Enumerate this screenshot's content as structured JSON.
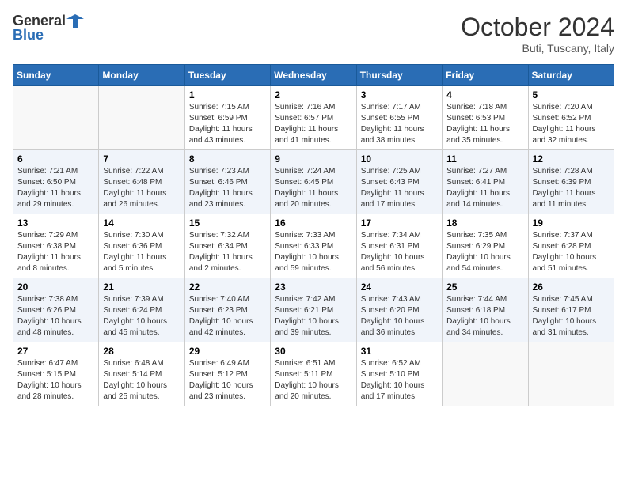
{
  "header": {
    "logo_line1": "General",
    "logo_line2": "Blue",
    "month": "October 2024",
    "location": "Buti, Tuscany, Italy"
  },
  "days_of_week": [
    "Sunday",
    "Monday",
    "Tuesday",
    "Wednesday",
    "Thursday",
    "Friday",
    "Saturday"
  ],
  "weeks": [
    [
      {
        "day": "",
        "info": ""
      },
      {
        "day": "",
        "info": ""
      },
      {
        "day": "1",
        "info": "Sunrise: 7:15 AM\nSunset: 6:59 PM\nDaylight: 11 hours\nand 43 minutes."
      },
      {
        "day": "2",
        "info": "Sunrise: 7:16 AM\nSunset: 6:57 PM\nDaylight: 11 hours\nand 41 minutes."
      },
      {
        "day": "3",
        "info": "Sunrise: 7:17 AM\nSunset: 6:55 PM\nDaylight: 11 hours\nand 38 minutes."
      },
      {
        "day": "4",
        "info": "Sunrise: 7:18 AM\nSunset: 6:53 PM\nDaylight: 11 hours\nand 35 minutes."
      },
      {
        "day": "5",
        "info": "Sunrise: 7:20 AM\nSunset: 6:52 PM\nDaylight: 11 hours\nand 32 minutes."
      }
    ],
    [
      {
        "day": "6",
        "info": "Sunrise: 7:21 AM\nSunset: 6:50 PM\nDaylight: 11 hours\nand 29 minutes."
      },
      {
        "day": "7",
        "info": "Sunrise: 7:22 AM\nSunset: 6:48 PM\nDaylight: 11 hours\nand 26 minutes."
      },
      {
        "day": "8",
        "info": "Sunrise: 7:23 AM\nSunset: 6:46 PM\nDaylight: 11 hours\nand 23 minutes."
      },
      {
        "day": "9",
        "info": "Sunrise: 7:24 AM\nSunset: 6:45 PM\nDaylight: 11 hours\nand 20 minutes."
      },
      {
        "day": "10",
        "info": "Sunrise: 7:25 AM\nSunset: 6:43 PM\nDaylight: 11 hours\nand 17 minutes."
      },
      {
        "day": "11",
        "info": "Sunrise: 7:27 AM\nSunset: 6:41 PM\nDaylight: 11 hours\nand 14 minutes."
      },
      {
        "day": "12",
        "info": "Sunrise: 7:28 AM\nSunset: 6:39 PM\nDaylight: 11 hours\nand 11 minutes."
      }
    ],
    [
      {
        "day": "13",
        "info": "Sunrise: 7:29 AM\nSunset: 6:38 PM\nDaylight: 11 hours\nand 8 minutes."
      },
      {
        "day": "14",
        "info": "Sunrise: 7:30 AM\nSunset: 6:36 PM\nDaylight: 11 hours\nand 5 minutes."
      },
      {
        "day": "15",
        "info": "Sunrise: 7:32 AM\nSunset: 6:34 PM\nDaylight: 11 hours\nand 2 minutes."
      },
      {
        "day": "16",
        "info": "Sunrise: 7:33 AM\nSunset: 6:33 PM\nDaylight: 10 hours\nand 59 minutes."
      },
      {
        "day": "17",
        "info": "Sunrise: 7:34 AM\nSunset: 6:31 PM\nDaylight: 10 hours\nand 56 minutes."
      },
      {
        "day": "18",
        "info": "Sunrise: 7:35 AM\nSunset: 6:29 PM\nDaylight: 10 hours\nand 54 minutes."
      },
      {
        "day": "19",
        "info": "Sunrise: 7:37 AM\nSunset: 6:28 PM\nDaylight: 10 hours\nand 51 minutes."
      }
    ],
    [
      {
        "day": "20",
        "info": "Sunrise: 7:38 AM\nSunset: 6:26 PM\nDaylight: 10 hours\nand 48 minutes."
      },
      {
        "day": "21",
        "info": "Sunrise: 7:39 AM\nSunset: 6:24 PM\nDaylight: 10 hours\nand 45 minutes."
      },
      {
        "day": "22",
        "info": "Sunrise: 7:40 AM\nSunset: 6:23 PM\nDaylight: 10 hours\nand 42 minutes."
      },
      {
        "day": "23",
        "info": "Sunrise: 7:42 AM\nSunset: 6:21 PM\nDaylight: 10 hours\nand 39 minutes."
      },
      {
        "day": "24",
        "info": "Sunrise: 7:43 AM\nSunset: 6:20 PM\nDaylight: 10 hours\nand 36 minutes."
      },
      {
        "day": "25",
        "info": "Sunrise: 7:44 AM\nSunset: 6:18 PM\nDaylight: 10 hours\nand 34 minutes."
      },
      {
        "day": "26",
        "info": "Sunrise: 7:45 AM\nSunset: 6:17 PM\nDaylight: 10 hours\nand 31 minutes."
      }
    ],
    [
      {
        "day": "27",
        "info": "Sunrise: 6:47 AM\nSunset: 5:15 PM\nDaylight: 10 hours\nand 28 minutes."
      },
      {
        "day": "28",
        "info": "Sunrise: 6:48 AM\nSunset: 5:14 PM\nDaylight: 10 hours\nand 25 minutes."
      },
      {
        "day": "29",
        "info": "Sunrise: 6:49 AM\nSunset: 5:12 PM\nDaylight: 10 hours\nand 23 minutes."
      },
      {
        "day": "30",
        "info": "Sunrise: 6:51 AM\nSunset: 5:11 PM\nDaylight: 10 hours\nand 20 minutes."
      },
      {
        "day": "31",
        "info": "Sunrise: 6:52 AM\nSunset: 5:10 PM\nDaylight: 10 hours\nand 17 minutes."
      },
      {
        "day": "",
        "info": ""
      },
      {
        "day": "",
        "info": ""
      }
    ]
  ]
}
